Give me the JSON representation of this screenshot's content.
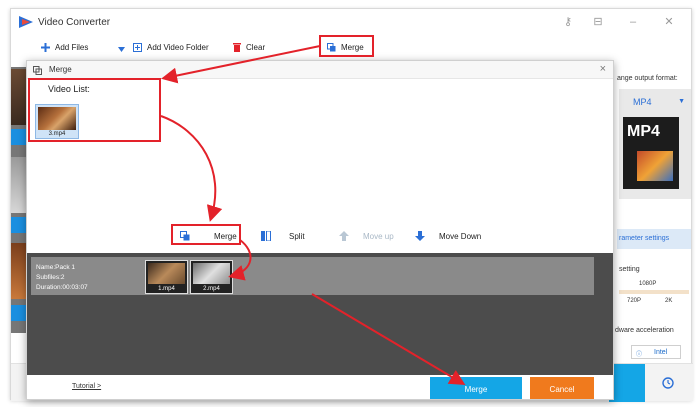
{
  "app": {
    "title": "Video Converter",
    "colors": {
      "accent": "#14a6e6",
      "cancel": "#f07a1d",
      "annotation": "#e3222a",
      "dark_area": "#4c4c4c"
    }
  },
  "toolbar": {
    "add_files": "Add Files",
    "add_video_folder": "Add Video Folder",
    "clear": "Clear",
    "merge": "Merge"
  },
  "right_panel": {
    "output_label": "ange output format:",
    "format": "MP4",
    "format_big": "MP4",
    "param_settings": "rameter settings",
    "setting_label": "setting",
    "quality_labels": [
      "1080P",
      "720P",
      "2K"
    ],
    "hw_accel": "dware acceleration",
    "intel": "Intel"
  },
  "dialog": {
    "title": "Merge",
    "close": "×",
    "video_list_label": "Video List:",
    "video_list": [
      {
        "name": "3.mp4"
      }
    ],
    "tools": {
      "merge": "Merge",
      "split": "Split",
      "move_up": "Move up",
      "move_down": "Move Down"
    },
    "pack": {
      "name": "Name:Pack 1",
      "subfiles": "Subfiles:2",
      "duration": "Duration:00:03:07",
      "clips": [
        {
          "name": "1.mp4"
        },
        {
          "name": "2.mp4"
        }
      ]
    },
    "footer": {
      "tutorial": "Tutorial >",
      "merge": "Merge",
      "cancel": "Cancel"
    }
  }
}
